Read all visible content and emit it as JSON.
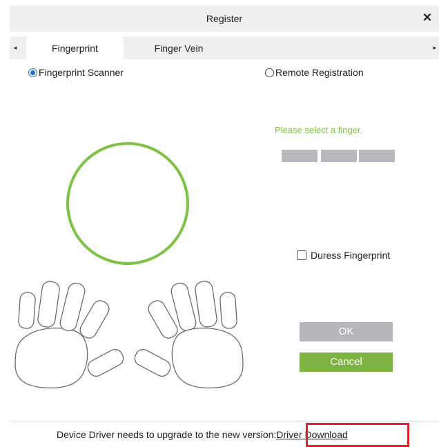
{
  "dialog": {
    "title": "Register",
    "close_symbol": "✕"
  },
  "tabs": {
    "scroll_left_symbol": "◂",
    "scroll_right_symbol": "▸",
    "items": [
      {
        "label": "Fingerprint",
        "active": true
      },
      {
        "label": "Finger Vein",
        "active": false
      }
    ]
  },
  "mode": {
    "options": [
      {
        "label": "Fingerprint Scanner",
        "checked": true
      },
      {
        "label": "Remote Registration",
        "checked": false
      }
    ]
  },
  "enroll": {
    "prompt": "Please select a finger.",
    "progress_segments": 3
  },
  "duress": {
    "label": "Duress Fingerprint",
    "checked": false
  },
  "buttons": {
    "ok_label": "OK",
    "cancel_label": "Cancel"
  },
  "footer": {
    "message": "Device Driver needs to upgrade to the new version:",
    "link_label": "Driver Download"
  },
  "colors": {
    "accent_green": "#7cc243",
    "cancel_green": "#7cb342",
    "disabled_gray": "#b4b6b9",
    "radio_blue": "#1e6fd9",
    "highlight_red": "#e0202a"
  }
}
